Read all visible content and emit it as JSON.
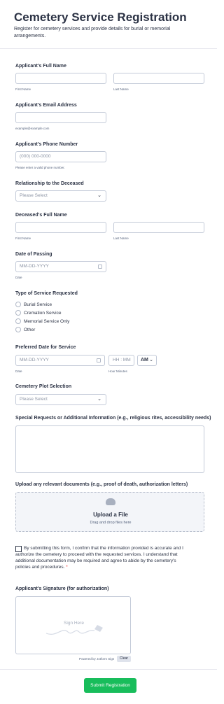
{
  "header": {
    "title": "Cemetery Service Registration",
    "subtitle": "Register for cemetery services and provide details for burial or memorial arrangements."
  },
  "full_name": {
    "label": "Applicant's Full Name",
    "first_sub": "First Name",
    "last_sub": "Last Name"
  },
  "email": {
    "label": "Applicant's Email Address",
    "sub": "example@example.com"
  },
  "phone": {
    "label": "Applicant's Phone Number",
    "placeholder": "(000) 000-0000",
    "sub": "Please enter a valid phone number."
  },
  "relationship": {
    "label": "Relationship to the Deceased",
    "selected": "Please Select"
  },
  "deceased_name": {
    "label": "Deceased's Full Name",
    "first_sub": "First Name",
    "last_sub": "Last Name"
  },
  "date_passing": {
    "label": "Date of Passing",
    "placeholder": "MM-DD-YYYY",
    "sub": "Date"
  },
  "service_type": {
    "label": "Type of Service Requested",
    "options": [
      "Burial Service",
      "Cremation Service",
      "Memorial Service Only",
      "Other"
    ]
  },
  "preferred_date": {
    "label": "Preferred Date for Service",
    "date_placeholder": "MM-DD-YYYY",
    "time_placeholder": "HH : MM",
    "ampm": "AM",
    "date_sub": "Date",
    "time_sub": "Hour Minutes"
  },
  "plot": {
    "label": "Cemetery Plot Selection",
    "selected": "Please Select"
  },
  "special_requests": {
    "label": "Special Requests or Additional Information (e.g., religious rites, accessibility needs)"
  },
  "upload": {
    "label": "Upload any relevant documents (e.g., proof of death, authorization letters)",
    "title": "Upload a File",
    "sub": "Drag and drop files here"
  },
  "consent": {
    "text": "By submitting this form, I confirm that the information provided is accurate and I authorize the cemetery to proceed with the requested services. I understand that additional documentation may be required and agree to abide by the cemetery's policies and procedures.",
    "required_mark": "*"
  },
  "signature": {
    "label": "Applicant's Signature (for authorization)",
    "placeholder": "Sign Here",
    "powered": "Powered by Jotform Sign",
    "clear": "Clear"
  },
  "submit_label": "Submit Registration",
  "colors": {
    "accent": "#18bd5b",
    "text": "#2c3345",
    "border": "#c3cad8",
    "required": "#f23a3c"
  },
  "icons": [
    "chevron-down-icon",
    "calendar-icon",
    "upload-cloud-icon",
    "signature-pen-icon"
  ]
}
